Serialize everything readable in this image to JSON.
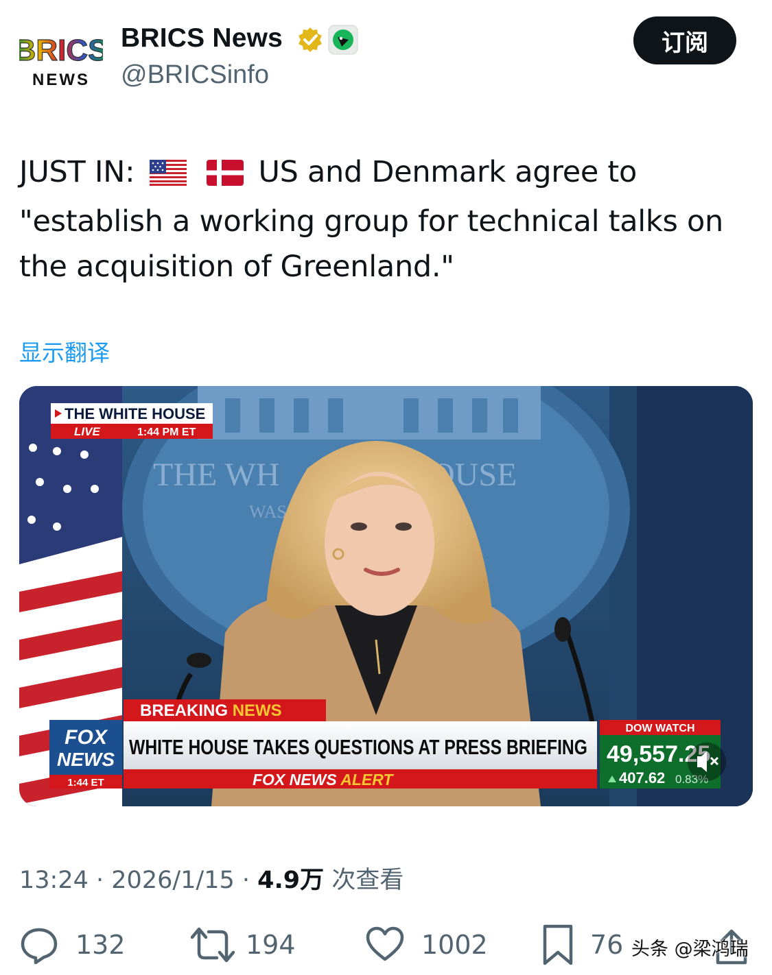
{
  "account": {
    "display_name": "BRICS News",
    "handle": "@BRICSinfo",
    "avatar_text_top": "BRICS",
    "avatar_text_bottom": "NEWS",
    "subscribe_label": "订阅"
  },
  "tweet": {
    "text_prefix": "JUST IN:",
    "text_main": "US and Denmark agree to \"establish a working group for technical talks on the acquisition of Greenland.\"",
    "translate_label": "显示翻译"
  },
  "video": {
    "live_source": "THE WHITE HOUSE",
    "live_label": "LIVE",
    "live_time": "1:44 PM ET",
    "backdrop_text_left": "THE WH",
    "backdrop_text_right": "OUSE",
    "backdrop_sub": "WAS",
    "breaking_word1": "BREAKING",
    "breaking_word2": "NEWS",
    "headline": "WHITE HOUSE TAKES QUESTIONS AT PRESS BRIEFING",
    "alert_word1": "FOX NEWS",
    "alert_word2": "ALERT",
    "logo_line1": "FOX",
    "logo_line2": "NEWS",
    "logo_time": "1:44 ET",
    "dow_label": "DOW WATCH",
    "dow_value": "49,557.25",
    "dow_change": "407.62",
    "dow_pct": "0.83%"
  },
  "meta": {
    "time": "13:24",
    "date": "2026/1/15",
    "views_count": "4.9万",
    "views_label": "次查看"
  },
  "actions": {
    "replies": "132",
    "reposts": "194",
    "likes": "1002",
    "bookmarks": "76"
  },
  "watermark": "头条 @梁鸿瑞",
  "colors": {
    "link": "#1d9bf0",
    "secondary_text": "#536471",
    "verified_gold": "#e2b719",
    "fox_red": "#d3171b"
  }
}
